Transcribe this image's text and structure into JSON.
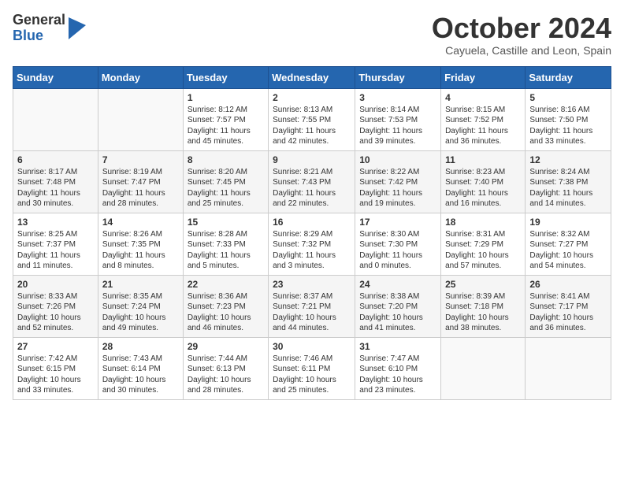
{
  "header": {
    "logo_general": "General",
    "logo_blue": "Blue",
    "month_title": "October 2024",
    "subtitle": "Cayuela, Castille and Leon, Spain"
  },
  "weekdays": [
    "Sunday",
    "Monday",
    "Tuesday",
    "Wednesday",
    "Thursday",
    "Friday",
    "Saturday"
  ],
  "weeks": [
    [
      {
        "day": "",
        "sunrise": "",
        "sunset": "",
        "daylight": ""
      },
      {
        "day": "",
        "sunrise": "",
        "sunset": "",
        "daylight": ""
      },
      {
        "day": "1",
        "sunrise": "Sunrise: 8:12 AM",
        "sunset": "Sunset: 7:57 PM",
        "daylight": "Daylight: 11 hours and 45 minutes."
      },
      {
        "day": "2",
        "sunrise": "Sunrise: 8:13 AM",
        "sunset": "Sunset: 7:55 PM",
        "daylight": "Daylight: 11 hours and 42 minutes."
      },
      {
        "day": "3",
        "sunrise": "Sunrise: 8:14 AM",
        "sunset": "Sunset: 7:53 PM",
        "daylight": "Daylight: 11 hours and 39 minutes."
      },
      {
        "day": "4",
        "sunrise": "Sunrise: 8:15 AM",
        "sunset": "Sunset: 7:52 PM",
        "daylight": "Daylight: 11 hours and 36 minutes."
      },
      {
        "day": "5",
        "sunrise": "Sunrise: 8:16 AM",
        "sunset": "Sunset: 7:50 PM",
        "daylight": "Daylight: 11 hours and 33 minutes."
      }
    ],
    [
      {
        "day": "6",
        "sunrise": "Sunrise: 8:17 AM",
        "sunset": "Sunset: 7:48 PM",
        "daylight": "Daylight: 11 hours and 30 minutes."
      },
      {
        "day": "7",
        "sunrise": "Sunrise: 8:19 AM",
        "sunset": "Sunset: 7:47 PM",
        "daylight": "Daylight: 11 hours and 28 minutes."
      },
      {
        "day": "8",
        "sunrise": "Sunrise: 8:20 AM",
        "sunset": "Sunset: 7:45 PM",
        "daylight": "Daylight: 11 hours and 25 minutes."
      },
      {
        "day": "9",
        "sunrise": "Sunrise: 8:21 AM",
        "sunset": "Sunset: 7:43 PM",
        "daylight": "Daylight: 11 hours and 22 minutes."
      },
      {
        "day": "10",
        "sunrise": "Sunrise: 8:22 AM",
        "sunset": "Sunset: 7:42 PM",
        "daylight": "Daylight: 11 hours and 19 minutes."
      },
      {
        "day": "11",
        "sunrise": "Sunrise: 8:23 AM",
        "sunset": "Sunset: 7:40 PM",
        "daylight": "Daylight: 11 hours and 16 minutes."
      },
      {
        "day": "12",
        "sunrise": "Sunrise: 8:24 AM",
        "sunset": "Sunset: 7:38 PM",
        "daylight": "Daylight: 11 hours and 14 minutes."
      }
    ],
    [
      {
        "day": "13",
        "sunrise": "Sunrise: 8:25 AM",
        "sunset": "Sunset: 7:37 PM",
        "daylight": "Daylight: 11 hours and 11 minutes."
      },
      {
        "day": "14",
        "sunrise": "Sunrise: 8:26 AM",
        "sunset": "Sunset: 7:35 PM",
        "daylight": "Daylight: 11 hours and 8 minutes."
      },
      {
        "day": "15",
        "sunrise": "Sunrise: 8:28 AM",
        "sunset": "Sunset: 7:33 PM",
        "daylight": "Daylight: 11 hours and 5 minutes."
      },
      {
        "day": "16",
        "sunrise": "Sunrise: 8:29 AM",
        "sunset": "Sunset: 7:32 PM",
        "daylight": "Daylight: 11 hours and 3 minutes."
      },
      {
        "day": "17",
        "sunrise": "Sunrise: 8:30 AM",
        "sunset": "Sunset: 7:30 PM",
        "daylight": "Daylight: 11 hours and 0 minutes."
      },
      {
        "day": "18",
        "sunrise": "Sunrise: 8:31 AM",
        "sunset": "Sunset: 7:29 PM",
        "daylight": "Daylight: 10 hours and 57 minutes."
      },
      {
        "day": "19",
        "sunrise": "Sunrise: 8:32 AM",
        "sunset": "Sunset: 7:27 PM",
        "daylight": "Daylight: 10 hours and 54 minutes."
      }
    ],
    [
      {
        "day": "20",
        "sunrise": "Sunrise: 8:33 AM",
        "sunset": "Sunset: 7:26 PM",
        "daylight": "Daylight: 10 hours and 52 minutes."
      },
      {
        "day": "21",
        "sunrise": "Sunrise: 8:35 AM",
        "sunset": "Sunset: 7:24 PM",
        "daylight": "Daylight: 10 hours and 49 minutes."
      },
      {
        "day": "22",
        "sunrise": "Sunrise: 8:36 AM",
        "sunset": "Sunset: 7:23 PM",
        "daylight": "Daylight: 10 hours and 46 minutes."
      },
      {
        "day": "23",
        "sunrise": "Sunrise: 8:37 AM",
        "sunset": "Sunset: 7:21 PM",
        "daylight": "Daylight: 10 hours and 44 minutes."
      },
      {
        "day": "24",
        "sunrise": "Sunrise: 8:38 AM",
        "sunset": "Sunset: 7:20 PM",
        "daylight": "Daylight: 10 hours and 41 minutes."
      },
      {
        "day": "25",
        "sunrise": "Sunrise: 8:39 AM",
        "sunset": "Sunset: 7:18 PM",
        "daylight": "Daylight: 10 hours and 38 minutes."
      },
      {
        "day": "26",
        "sunrise": "Sunrise: 8:41 AM",
        "sunset": "Sunset: 7:17 PM",
        "daylight": "Daylight: 10 hours and 36 minutes."
      }
    ],
    [
      {
        "day": "27",
        "sunrise": "Sunrise: 7:42 AM",
        "sunset": "Sunset: 6:15 PM",
        "daylight": "Daylight: 10 hours and 33 minutes."
      },
      {
        "day": "28",
        "sunrise": "Sunrise: 7:43 AM",
        "sunset": "Sunset: 6:14 PM",
        "daylight": "Daylight: 10 hours and 30 minutes."
      },
      {
        "day": "29",
        "sunrise": "Sunrise: 7:44 AM",
        "sunset": "Sunset: 6:13 PM",
        "daylight": "Daylight: 10 hours and 28 minutes."
      },
      {
        "day": "30",
        "sunrise": "Sunrise: 7:46 AM",
        "sunset": "Sunset: 6:11 PM",
        "daylight": "Daylight: 10 hours and 25 minutes."
      },
      {
        "day": "31",
        "sunrise": "Sunrise: 7:47 AM",
        "sunset": "Sunset: 6:10 PM",
        "daylight": "Daylight: 10 hours and 23 minutes."
      },
      {
        "day": "",
        "sunrise": "",
        "sunset": "",
        "daylight": ""
      },
      {
        "day": "",
        "sunrise": "",
        "sunset": "",
        "daylight": ""
      }
    ]
  ]
}
